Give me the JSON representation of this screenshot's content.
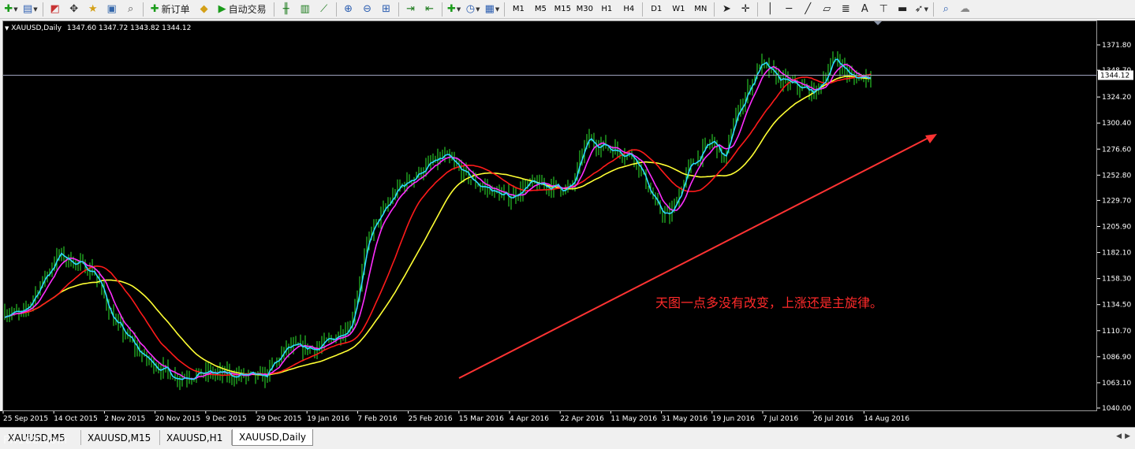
{
  "toolbar": {
    "new_order_label": "新订单",
    "auto_trading_label": "自动交易",
    "timeframes": [
      "M1",
      "M5",
      "M15",
      "M30",
      "H1",
      "H4",
      "D1",
      "W1",
      "MN"
    ]
  },
  "chart": {
    "symbol": "XAUUSD,Daily",
    "ohlc": "1347.60 1347.72 1343.82 1344.12",
    "current_price": "1344.12",
    "annotation": "天图一点多没有改变，上涨还是主旋律。",
    "price_ticks": [
      1371.8,
      1348.7,
      1324.2,
      1300.4,
      1276.6,
      1252.8,
      1229.7,
      1205.9,
      1182.1,
      1158.3,
      1134.5,
      1110.7,
      1086.9,
      1063.1,
      1040.0
    ],
    "date_ticks": [
      "25 Sep 2015",
      "14 Oct 2015",
      "2 Nov 2015",
      "20 Nov 2015",
      "9 Dec 2015",
      "29 Dec 2015",
      "19 Jan 2016",
      "7 Feb 2016",
      "25 Feb 2016",
      "15 Mar 2016",
      "4 Apr 2016",
      "22 Apr 2016",
      "11 May 2016",
      "31 May 2016",
      "19 Jun 2016",
      "7 Jul 2016",
      "26 Jul 2016",
      "14 Aug 2016"
    ],
    "colors": {
      "candles": "#2ee82e",
      "ma_fast": "#2ed8ff",
      "ma_mid": "#ff2eff",
      "ma_slow": "#ff1a1a",
      "ma_slowest": "#ffff33",
      "arrow": "#ff3333",
      "grid_line": "#9ea2bd"
    }
  },
  "tabs": [
    "XAUUSD,M5",
    "XAUUSD,M15",
    "XAUUSD,H1",
    "XAUUSD,Daily"
  ],
  "watermark": "FX168.com"
}
